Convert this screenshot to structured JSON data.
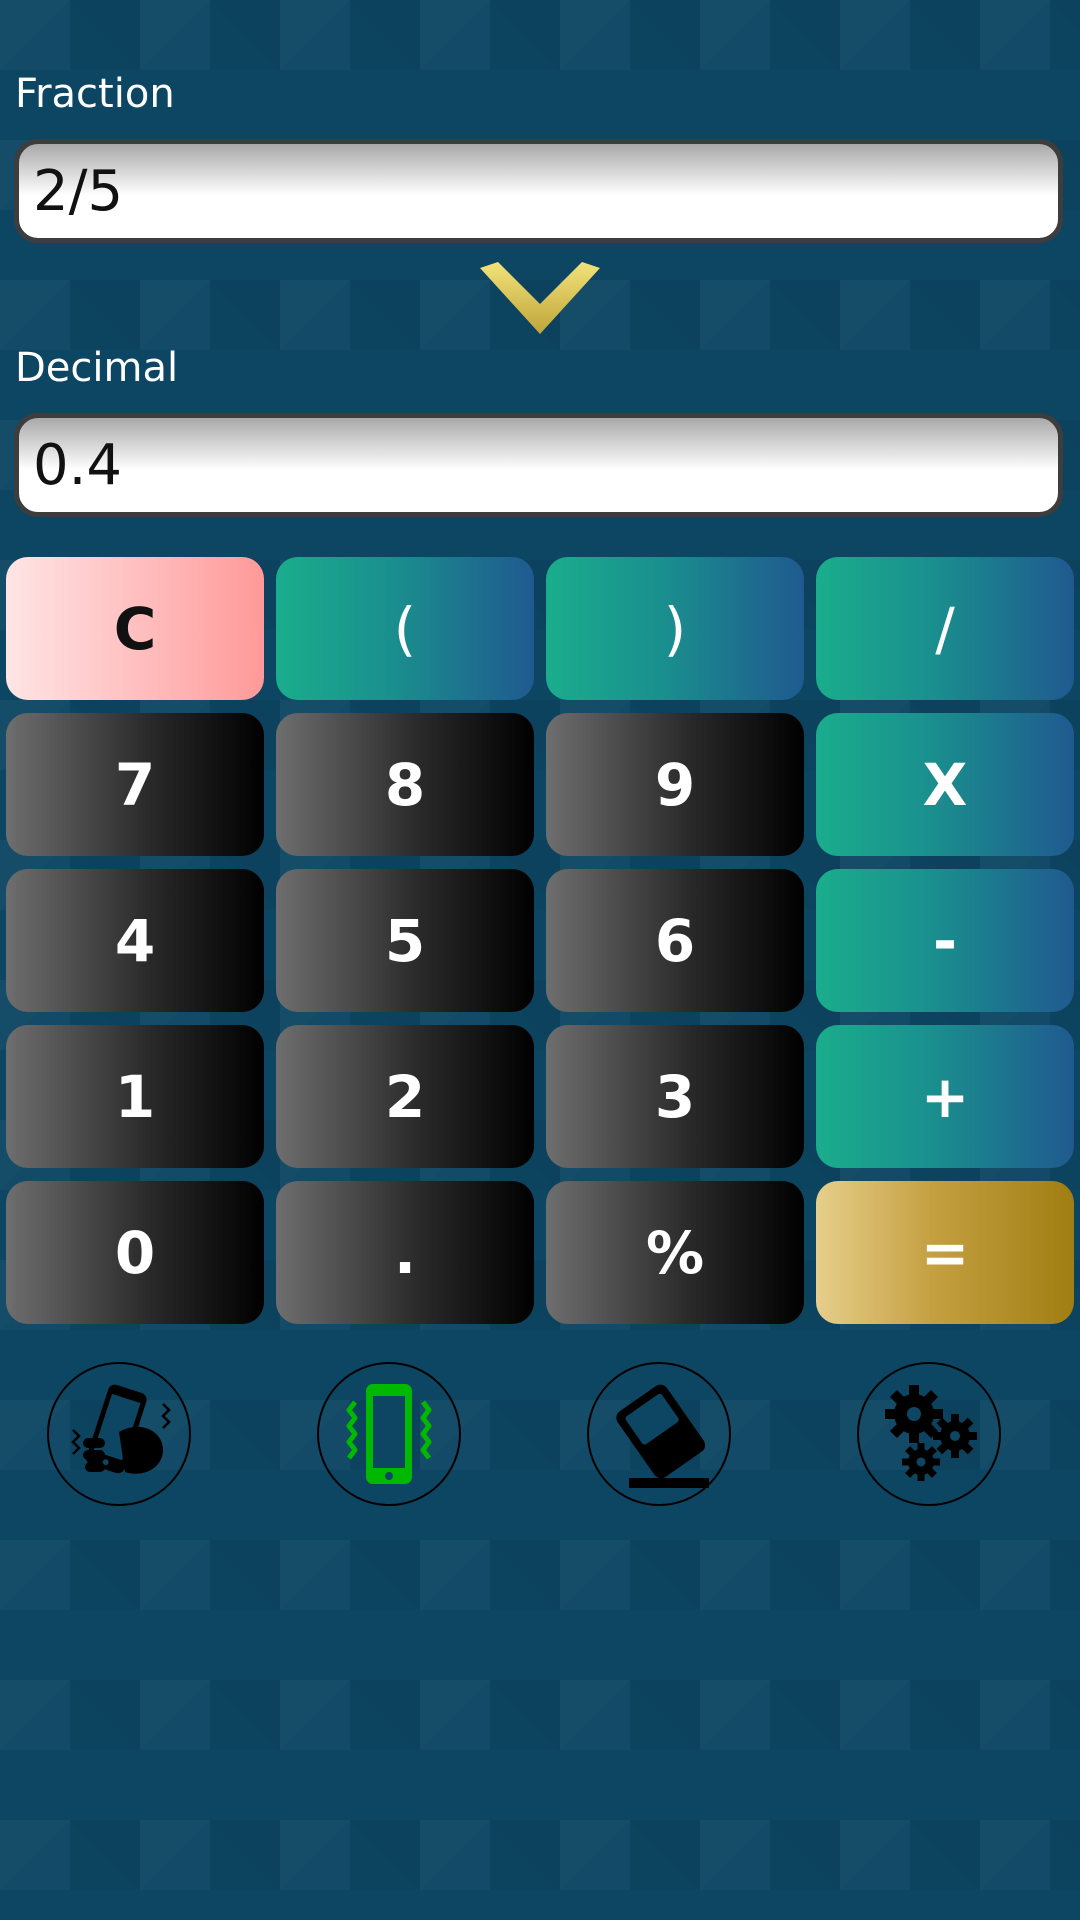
{
  "fraction": {
    "label": "Fraction",
    "value": "2/5"
  },
  "decimal": {
    "label": "Decimal",
    "value": "0.4"
  },
  "convert_icon": "chevron-down-icon",
  "keypad": {
    "clear": "C",
    "open_paren": "(",
    "close_paren": ")",
    "divide": "/",
    "seven": "7",
    "eight": "8",
    "nine": "9",
    "multiply": "X",
    "four": "4",
    "five": "5",
    "six": "6",
    "minus": "-",
    "one": "1",
    "two": "2",
    "three": "3",
    "plus": "+",
    "zero": "0",
    "dot": ".",
    "percent": "%",
    "equals": "="
  },
  "tools": [
    {
      "icon": "shake-phone-icon"
    },
    {
      "icon": "vibrate-icon"
    },
    {
      "icon": "eraser-icon"
    },
    {
      "icon": "settings-gears-icon"
    }
  ],
  "colors": {
    "background": "#0d4663",
    "operator": "#1aad8c",
    "equals": "#c4a041",
    "clear": "#ffb8b8",
    "vibrate_active": "#00b800",
    "chevron": "#e8d35a"
  }
}
